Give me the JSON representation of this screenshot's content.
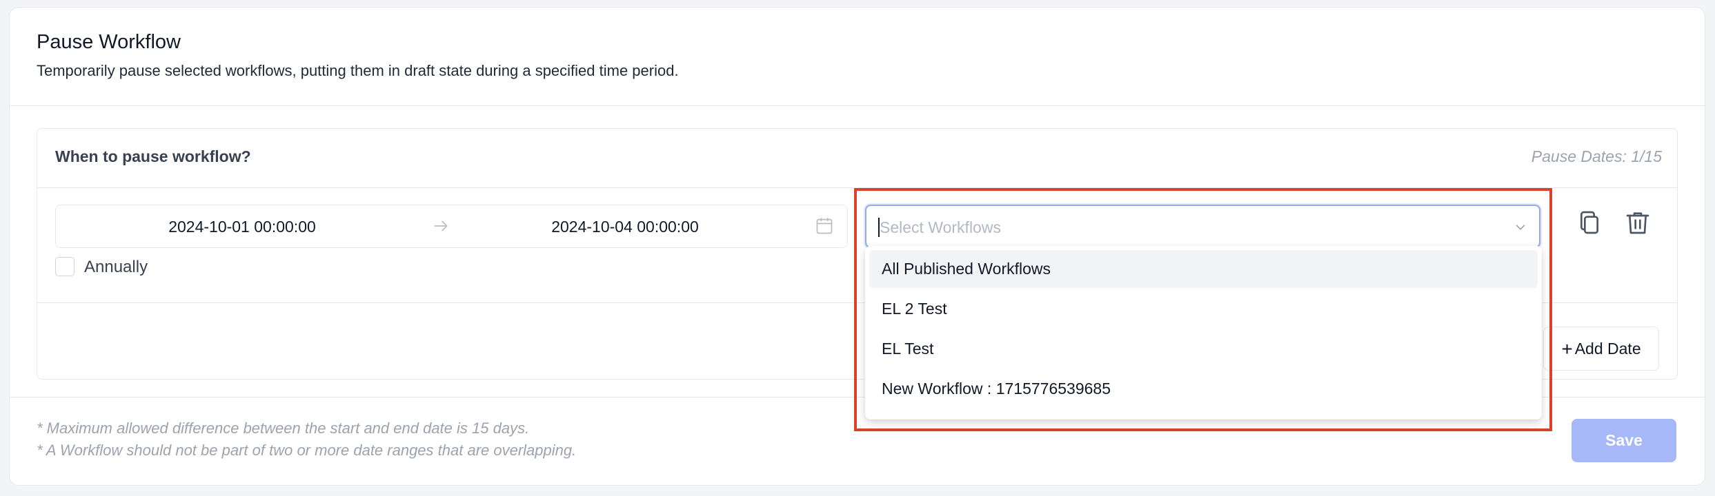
{
  "header": {
    "title": "Pause Workflow",
    "subtitle": "Temporarily pause selected workflows, putting them in draft state during a specified time period."
  },
  "section": {
    "title": "When to pause workflow?",
    "pause_count": "Pause Dates: 1/15"
  },
  "date_range": {
    "start": "2024-10-01 00:00:00",
    "end": "2024-10-04 00:00:00"
  },
  "annually": {
    "label": "Annually",
    "checked": false
  },
  "workflow_select": {
    "placeholder": "Select Workflows",
    "options": [
      "All Published Workflows",
      "EL 2 Test",
      "EL Test",
      "New Workflow : 1715776539685"
    ]
  },
  "add_date": {
    "label": "Add Date"
  },
  "notes": [
    "* Maximum allowed difference between the start and end date is 15 days.",
    "* A Workflow should not be part of two or more date ranges that are overlapping."
  ],
  "save": {
    "label": "Save"
  },
  "colors": {
    "highlight": "#d9412a",
    "save_bg": "#a6b8f7",
    "focus_border": "#93a8f0"
  },
  "icons": [
    "arrow-right-icon",
    "calendar-icon",
    "chevron-down-icon",
    "copy-icon",
    "trash-icon",
    "plus-icon"
  ]
}
